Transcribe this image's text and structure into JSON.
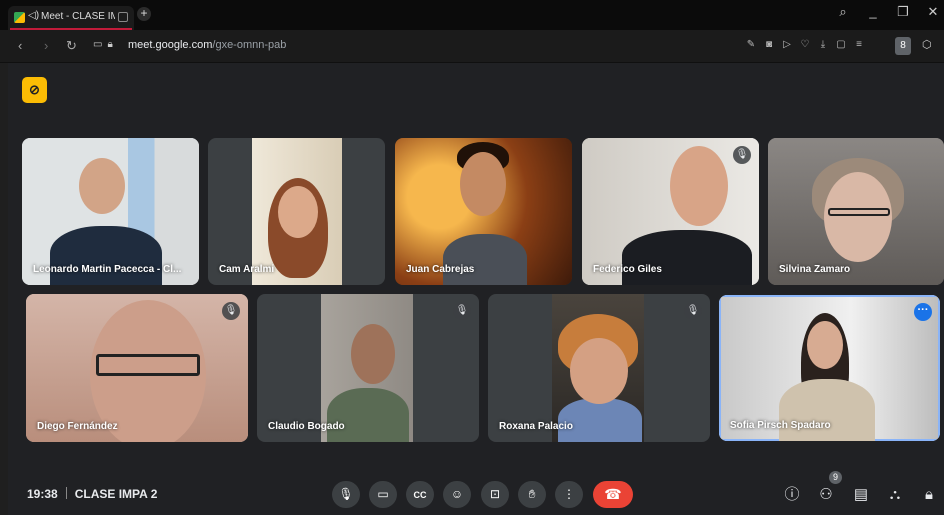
{
  "browser": {
    "tab_title": "Meet - CLASE IMP",
    "audio_indicator": "◁)",
    "new_tab": "+",
    "window_controls": [
      "search-icon",
      "minimize-icon",
      "restore-icon",
      "close-icon"
    ],
    "url_host": "meet.google.com",
    "url_path": "/gxe-omnn-pab",
    "profile_initial": "8"
  },
  "meeting": {
    "time": "19:38",
    "name": "CLASE IMPA 2",
    "people_count": "9",
    "accent_color": "#1a73e8",
    "hangup_color": "#ea4335",
    "camera_off_badge_color": "#fbbc04"
  },
  "participants": [
    {
      "name": "Leonardo Martin Pacecca - Cl...",
      "muted": false
    },
    {
      "name": "Cam Aralmi",
      "muted": false
    },
    {
      "name": "Juan Cabrejas",
      "muted": false
    },
    {
      "name": "Federico Giles",
      "muted": true
    },
    {
      "name": "Silvina Zamaro",
      "muted": false
    },
    {
      "name": "Diego Fernández",
      "muted": true
    },
    {
      "name": "Claudio Bogado",
      "muted": true
    },
    {
      "name": "Roxana Palacio",
      "muted": true
    },
    {
      "name": "Sofia Pirsch Spadaro",
      "muted": false,
      "active_speaker": true
    }
  ],
  "controls": [
    "microphone-icon",
    "camera-icon",
    "captions-icon",
    "emoji-icon",
    "present-icon",
    "raise-hand-icon",
    "more-options-icon",
    "hangup-icon"
  ],
  "right_controls": [
    "info-icon",
    "people-icon",
    "chat-icon",
    "activities-icon",
    "host-controls-icon"
  ]
}
